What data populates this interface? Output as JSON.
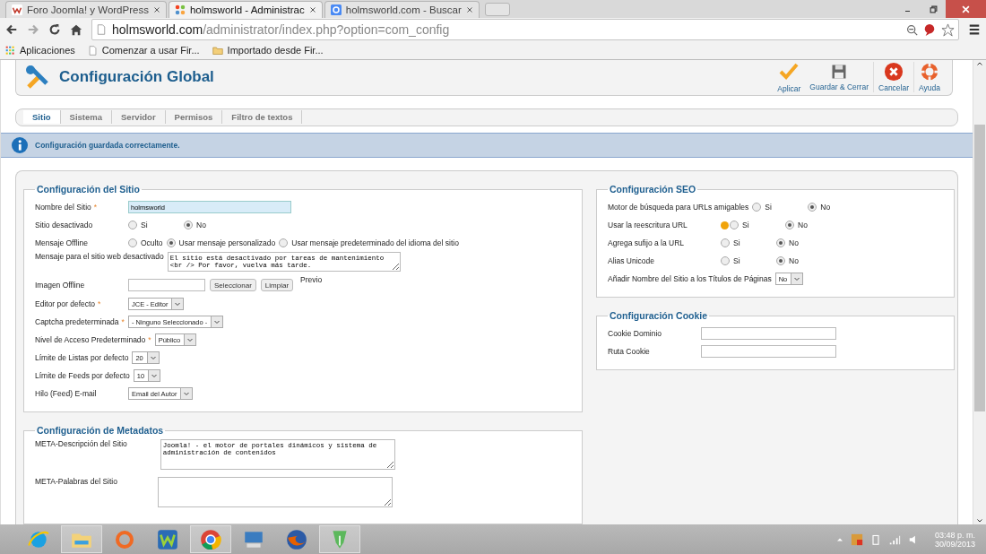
{
  "browser": {
    "tabs": [
      {
        "title": "Foro Joomla! y WordPress",
        "kind": "forum",
        "selected": false
      },
      {
        "title": "holmsworld - Administrac",
        "kind": "joomla",
        "selected": true
      },
      {
        "title": "holmsworld.com - Buscar",
        "kind": "search",
        "selected": false
      }
    ],
    "url": {
      "domain": "holmsworld.com",
      "path": "/administrator/index.php?option=com_config"
    },
    "bookmarks": [
      {
        "label": "Aplicaciones",
        "kind": "apps"
      },
      {
        "label": "Comenzar a usar Fir...",
        "kind": "page"
      },
      {
        "label": "Importado desde Fir...",
        "kind": "folder"
      }
    ]
  },
  "header": {
    "title": "Configuración Global",
    "buttons": [
      {
        "label": "Aplicar",
        "kind": "apply"
      },
      {
        "label": "Guardar & Cerrar",
        "kind": "save"
      },
      {
        "label": "Cancelar",
        "kind": "cancel"
      },
      {
        "label": "Ayuda",
        "kind": "help"
      }
    ]
  },
  "tabs": [
    {
      "label": "Sitio",
      "selected": true
    },
    {
      "label": "Sistema",
      "selected": false
    },
    {
      "label": "Servidor",
      "selected": false
    },
    {
      "label": "Permisos",
      "selected": false
    },
    {
      "label": "Filtro de textos",
      "selected": false
    }
  ],
  "message": "Configuración guardada correctamente.",
  "left_sections": [
    {
      "title": "Configuración del Sitio",
      "fields": [
        {
          "label": "Nombre del Sitio",
          "kind": "text",
          "required_mark": "*",
          "value": "holmsworld"
        },
        {
          "label": "Sitio desactivado",
          "kind": "radio",
          "options": [
            {
              "label": "Si",
              "selected": false
            },
            {
              "label": "No",
              "selected": true
            }
          ]
        },
        {
          "label": "Mensaje Offline",
          "kind": "radio",
          "options": [
            {
              "label": "Oculto",
              "selected": false
            },
            {
              "label": "Usar mensaje personalizado",
              "selected": true
            },
            {
              "label": "Usar mensaje predeterminado del idioma del sitio",
              "selected": false
            }
          ]
        },
        {
          "label": "Mensaje para el sitio web desactivado",
          "kind": "textarea",
          "value": "El sitio está desactivado por tareas de mantenimiento <br /> Por favor, vuelva más tarde."
        },
        {
          "label": "Imagen Offline",
          "kind": "media",
          "buttons": [
            "Seleccionar",
            "Limpiar"
          ],
          "preview": "Previo"
        },
        {
          "label": "Editor por defecto",
          "kind": "select",
          "required_mark": "*",
          "value": "JCE - Editor"
        },
        {
          "label": "Captcha predeterminada",
          "kind": "select",
          "required_mark": "*",
          "value": "- Ninguno Seleccionado -"
        },
        {
          "label": "Nivel de Acceso Predeterminado",
          "kind": "select",
          "required_mark": "*",
          "value": "Público"
        },
        {
          "label": "Límite de Listas por defecto",
          "kind": "select",
          "value": "20"
        },
        {
          "label": "Límite de Feeds por defecto",
          "kind": "select",
          "value": "10"
        },
        {
          "label": "Hilo (Feed) E-mail",
          "kind": "select",
          "value": "Email del Autor"
        }
      ]
    },
    {
      "title": "Configuración de Metadatos",
      "fields": [
        {
          "label": "META-Descripción del Sitio",
          "kind": "textarea",
          "value": "Joomla! - el motor de portales dinámicos y sistema de administración de contenidos"
        },
        {
          "label": "META-Palabras del Sitio",
          "kind": "textarea"
        }
      ]
    }
  ],
  "right_sections": [
    {
      "title": "Configuración SEO",
      "fields": [
        {
          "label": "Motor de búsqueda para URLs amigables",
          "kind": "radio",
          "options": [
            {
              "label": "Si",
              "selected": false
            },
            {
              "label": "No",
              "selected": true
            }
          ]
        },
        {
          "label": "Usar la reescritura URL",
          "kind": "radio",
          "warning": true,
          "options": [
            {
              "label": "Si",
              "selected": false
            },
            {
              "label": "No",
              "selected": true
            }
          ]
        },
        {
          "label": "Agrega sufijo a la URL",
          "kind": "radio",
          "options": [
            {
              "label": "Si",
              "selected": false
            },
            {
              "label": "No",
              "selected": true
            }
          ]
        },
        {
          "label": "Alias Unicode",
          "kind": "radio",
          "options": [
            {
              "label": "Si",
              "selected": false
            },
            {
              "label": "No",
              "selected": true
            }
          ]
        },
        {
          "label": "Añadir Nombre del Sitio a los Títulos de Páginas",
          "kind": "select",
          "value": "No"
        }
      ]
    },
    {
      "title": "Configuración Cookie",
      "fields": [
        {
          "label": "Cookie Dominio",
          "kind": "text"
        },
        {
          "label": "Ruta Cookie",
          "kind": "text"
        }
      ]
    }
  ],
  "taskbar": {
    "apps": [
      {
        "kind": "ie",
        "running": false
      },
      {
        "kind": "explorer",
        "running": true
      },
      {
        "kind": "origin",
        "running": false
      },
      {
        "kind": "w",
        "running": false
      },
      {
        "kind": "chrome",
        "running": true
      },
      {
        "kind": "keyboard",
        "running": false
      },
      {
        "kind": "firefox",
        "running": false
      },
      {
        "kind": "pen",
        "running": true
      }
    ],
    "time": "03:48 p. m.",
    "date": "30/09/2013"
  }
}
